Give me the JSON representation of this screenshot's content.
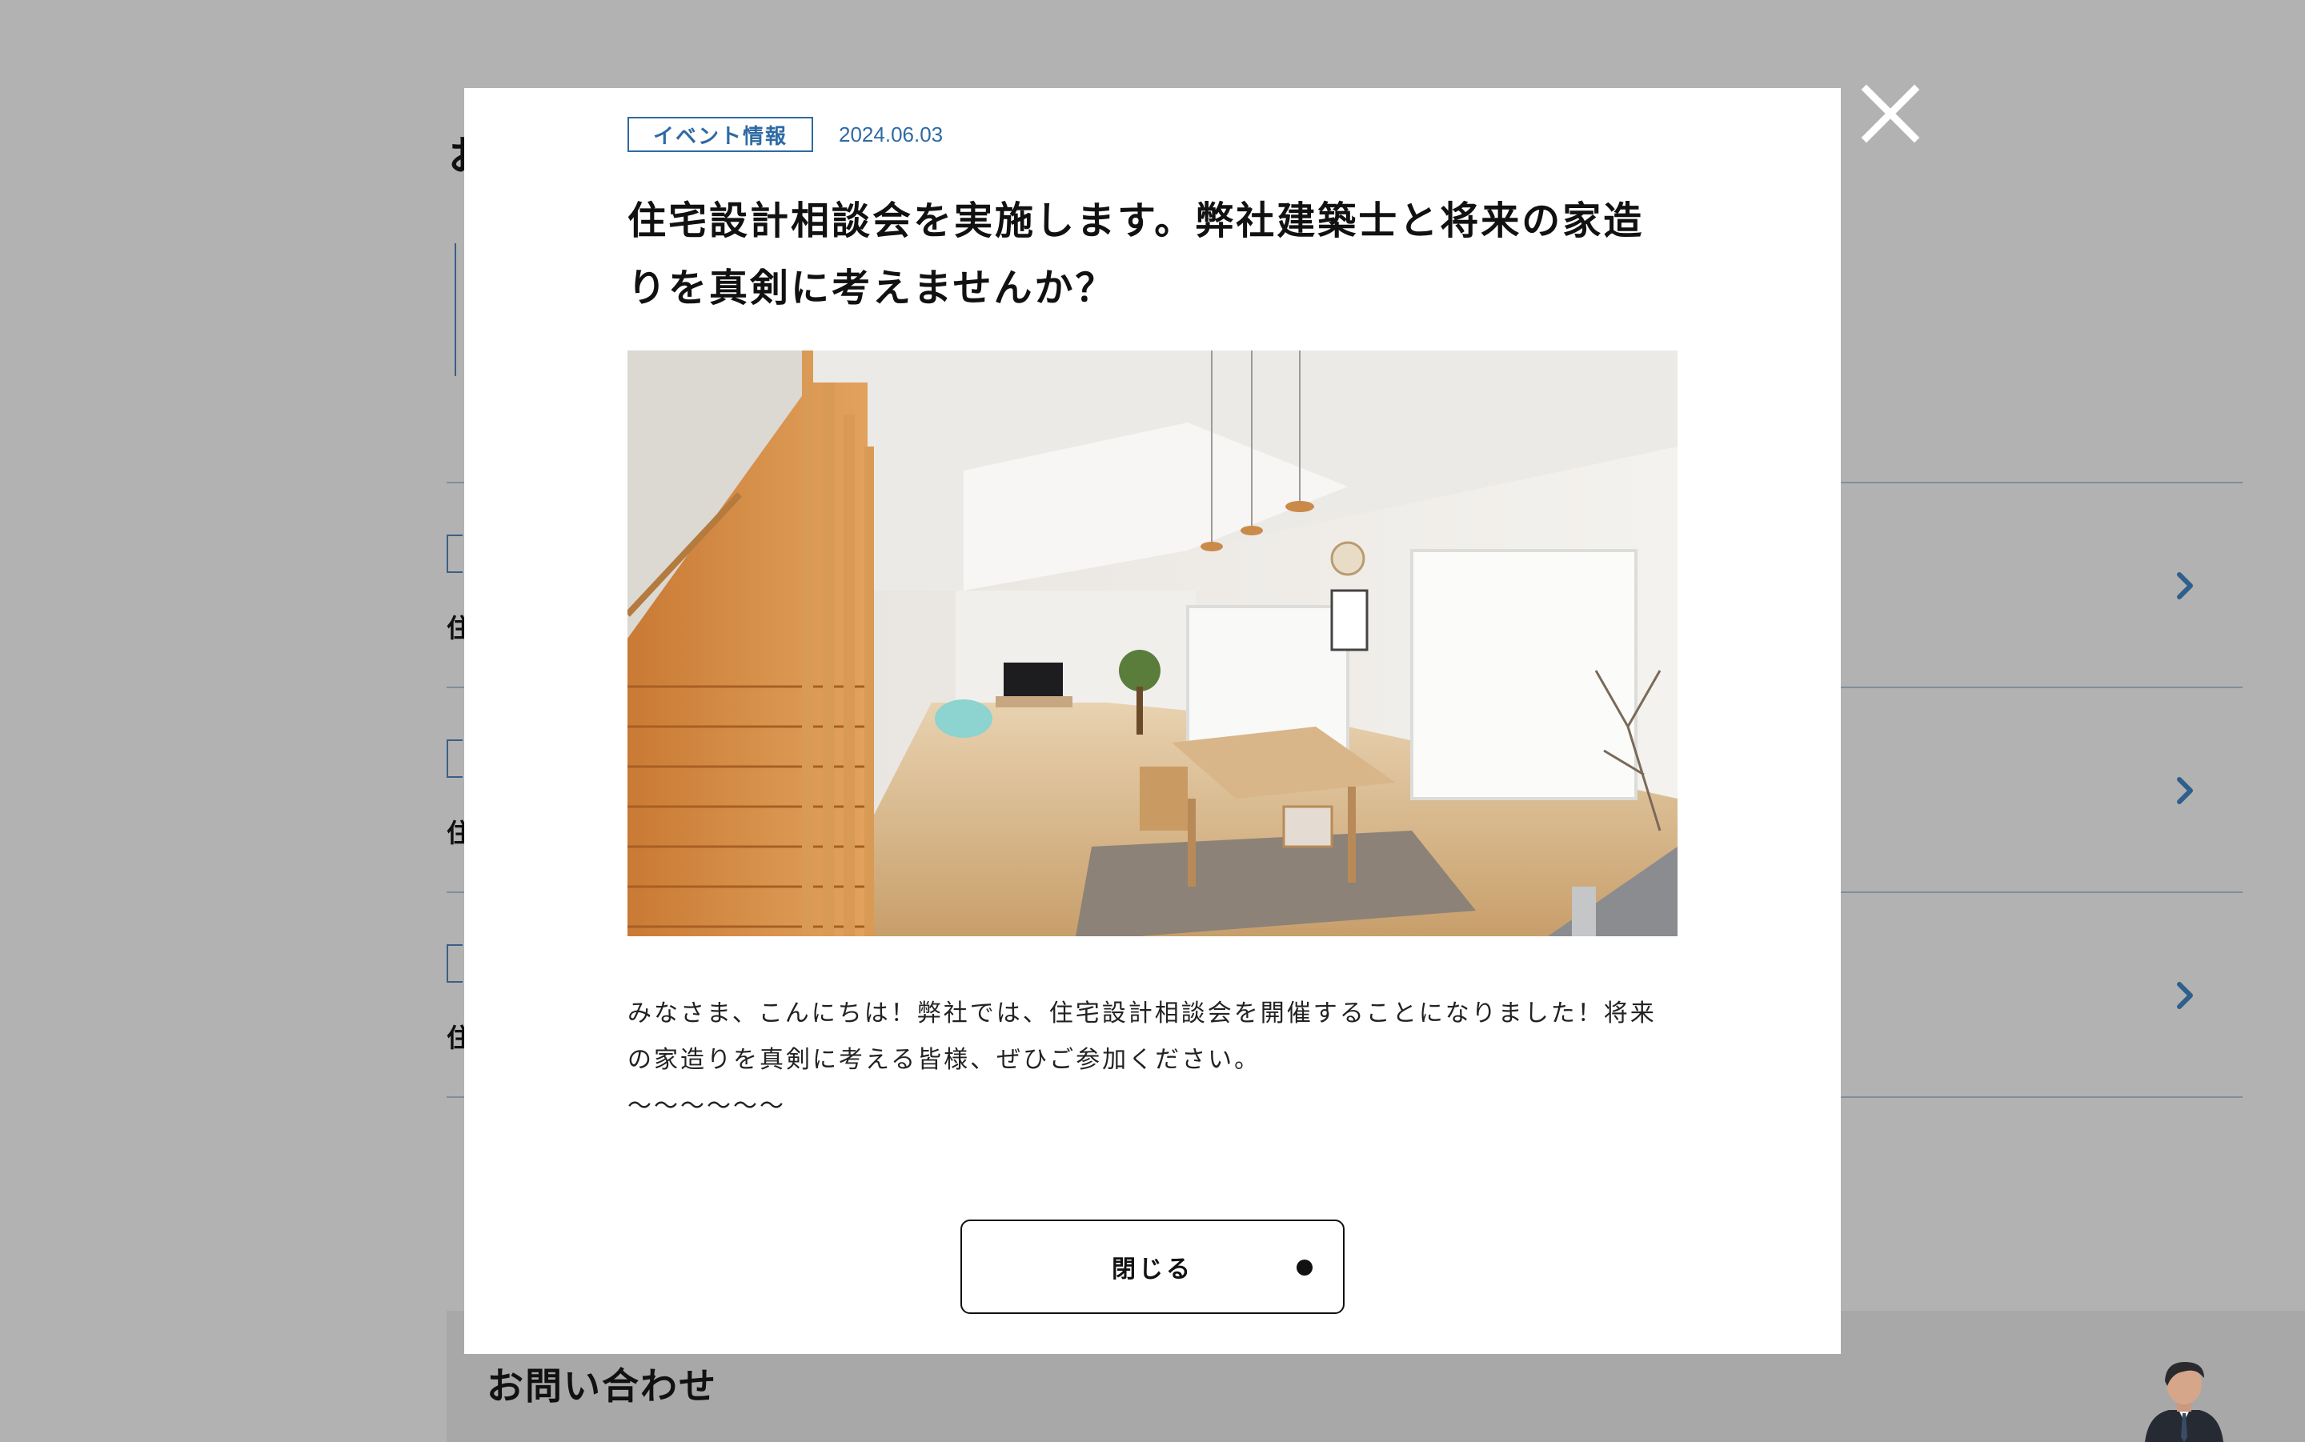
{
  "background": {
    "heading_partial": "お",
    "rows": [
      {
        "title_partial": "住"
      },
      {
        "title_partial": "住"
      },
      {
        "title_partial": "住"
      }
    ],
    "contact_title": "お問い合わせ"
  },
  "modal": {
    "category": "イベント情報",
    "date": "2024.06.03",
    "title": "住宅設計相談会を実施します。弊社建築士と将来の家造りを真剣に考えませんか？",
    "body_lines": [
      "みなさま、こんにちは！弊社では、住宅設計相談会を開催することになりました！将来の家造りを真剣に考える皆様、ぜひご参加ください。",
      "〜〜〜〜〜〜"
    ],
    "close_button_label": "閉じる"
  },
  "icons": {
    "close": "close-x-icon",
    "chevron": "chevron-right-icon"
  },
  "colors": {
    "accent": "#2f6aa3",
    "overlay": "#b2b2b2",
    "modal_bg": "#ffffff"
  }
}
